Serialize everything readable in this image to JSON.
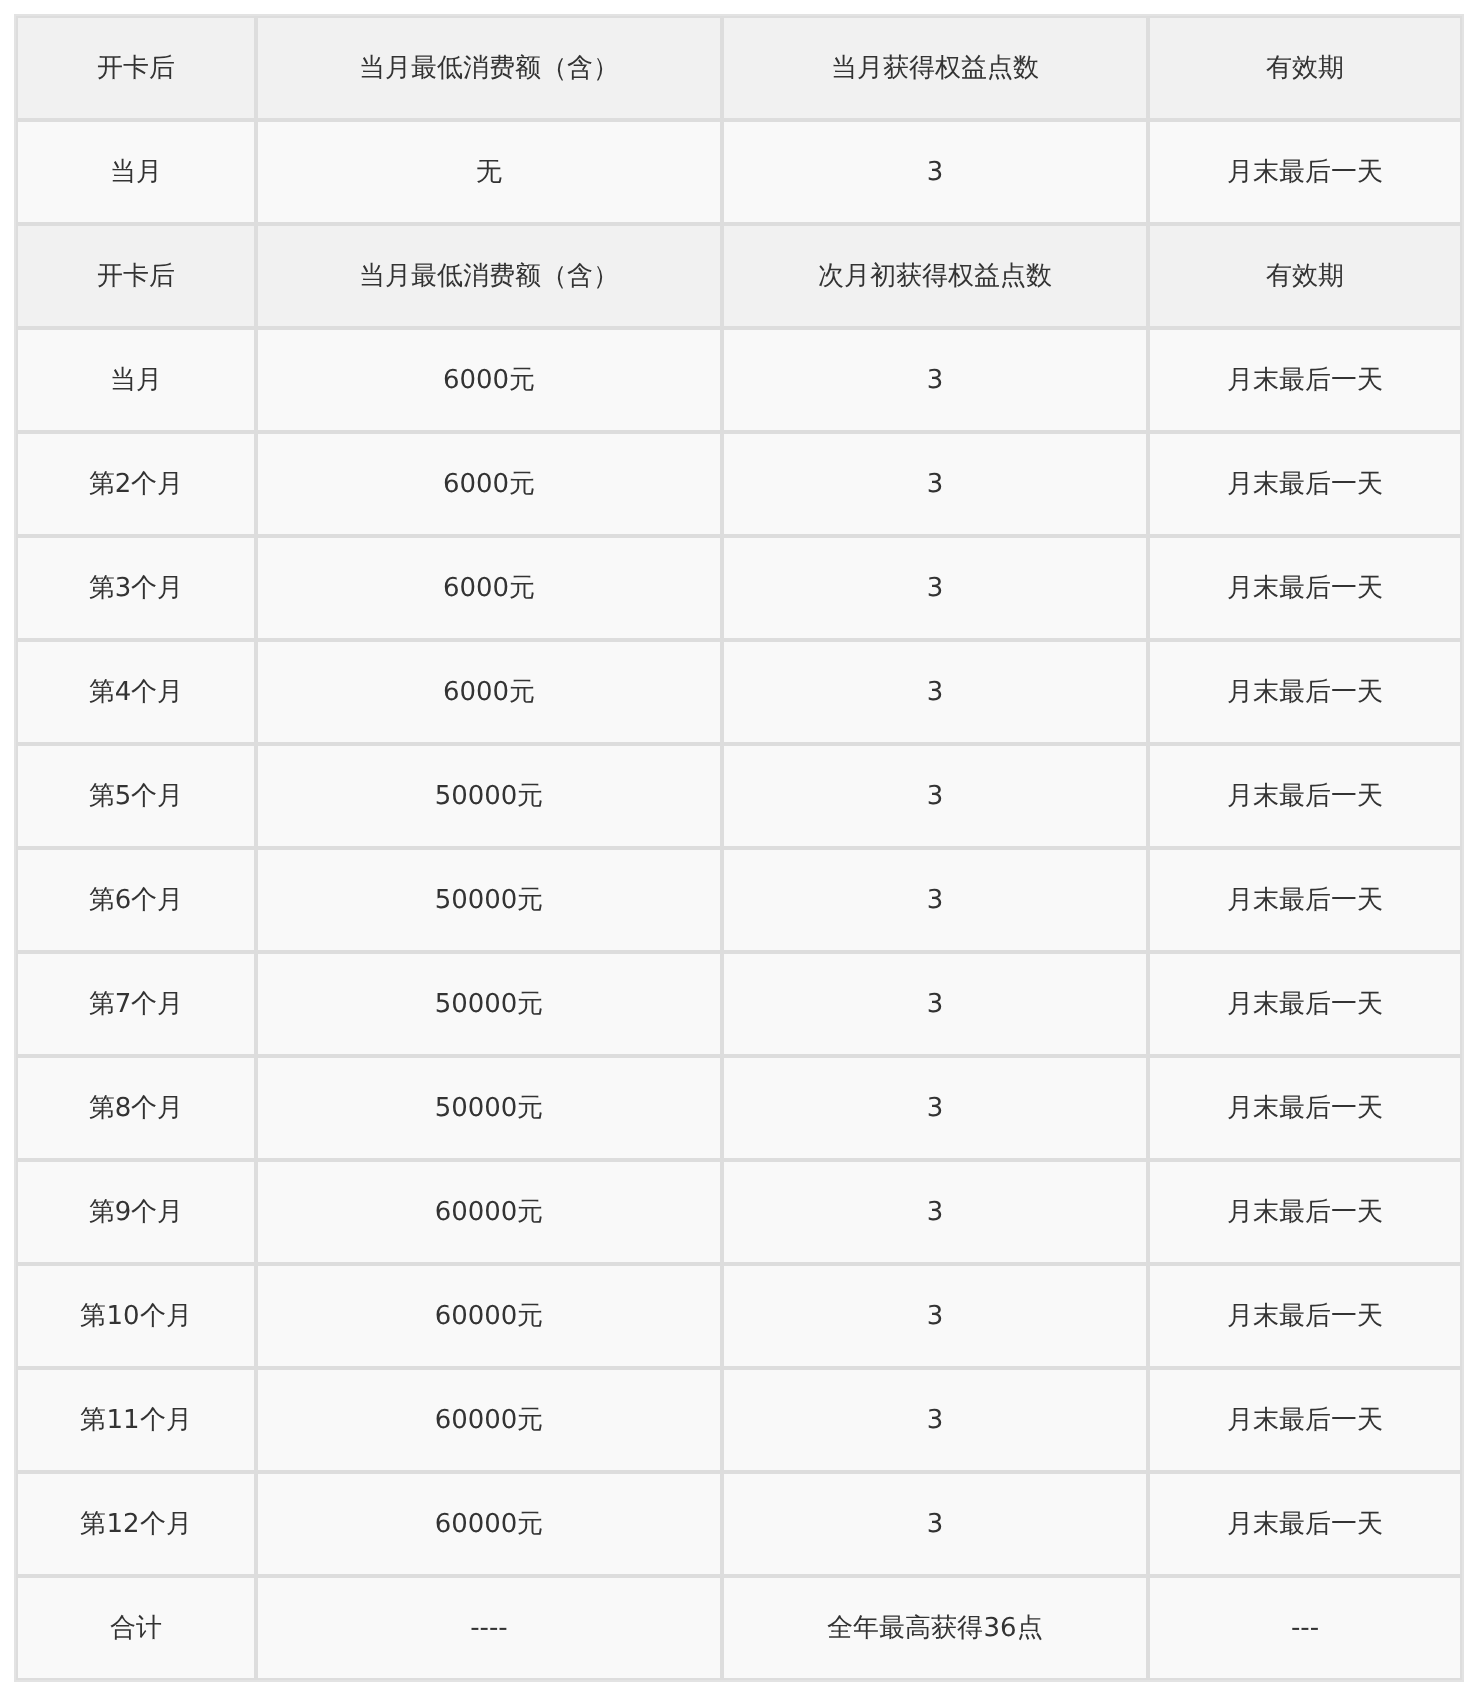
{
  "table": {
    "rows": [
      {
        "kind": "header",
        "cells": [
          "开卡后",
          "当月最低消费额（含）",
          "当月获得权益点数",
          "有效期"
        ]
      },
      {
        "kind": "data",
        "cells": [
          "当月",
          "无",
          "3",
          "月末最后一天"
        ]
      },
      {
        "kind": "header",
        "cells": [
          "开卡后",
          "当月最低消费额（含）",
          "次月初获得权益点数",
          "有效期"
        ]
      },
      {
        "kind": "data",
        "cells": [
          "当月",
          "6000元",
          "3",
          "月末最后一天"
        ]
      },
      {
        "kind": "data",
        "cells": [
          "第2个月",
          "6000元",
          "3",
          "月末最后一天"
        ]
      },
      {
        "kind": "data",
        "cells": [
          "第3个月",
          "6000元",
          "3",
          "月末最后一天"
        ]
      },
      {
        "kind": "data",
        "cells": [
          "第4个月",
          "6000元",
          "3",
          "月末最后一天"
        ]
      },
      {
        "kind": "data",
        "cells": [
          "第5个月",
          "50000元",
          "3",
          "月末最后一天"
        ]
      },
      {
        "kind": "data",
        "cells": [
          "第6个月",
          "50000元",
          "3",
          "月末最后一天"
        ]
      },
      {
        "kind": "data",
        "cells": [
          "第7个月",
          "50000元",
          "3",
          "月末最后一天"
        ]
      },
      {
        "kind": "data",
        "cells": [
          "第8个月",
          "50000元",
          "3",
          "月末最后一天"
        ]
      },
      {
        "kind": "data",
        "cells": [
          "第9个月",
          "60000元",
          "3",
          "月末最后一天"
        ]
      },
      {
        "kind": "data",
        "cells": [
          "第10个月",
          "60000元",
          "3",
          "月末最后一天"
        ]
      },
      {
        "kind": "data",
        "cells": [
          "第11个月",
          "60000元",
          "3",
          "月末最后一天"
        ]
      },
      {
        "kind": "data",
        "cells": [
          "第12个月",
          "60000元",
          "3",
          "月末最后一天"
        ]
      },
      {
        "kind": "data",
        "cells": [
          "合计",
          "----",
          "全年最高获得36点",
          "---"
        ]
      }
    ]
  }
}
